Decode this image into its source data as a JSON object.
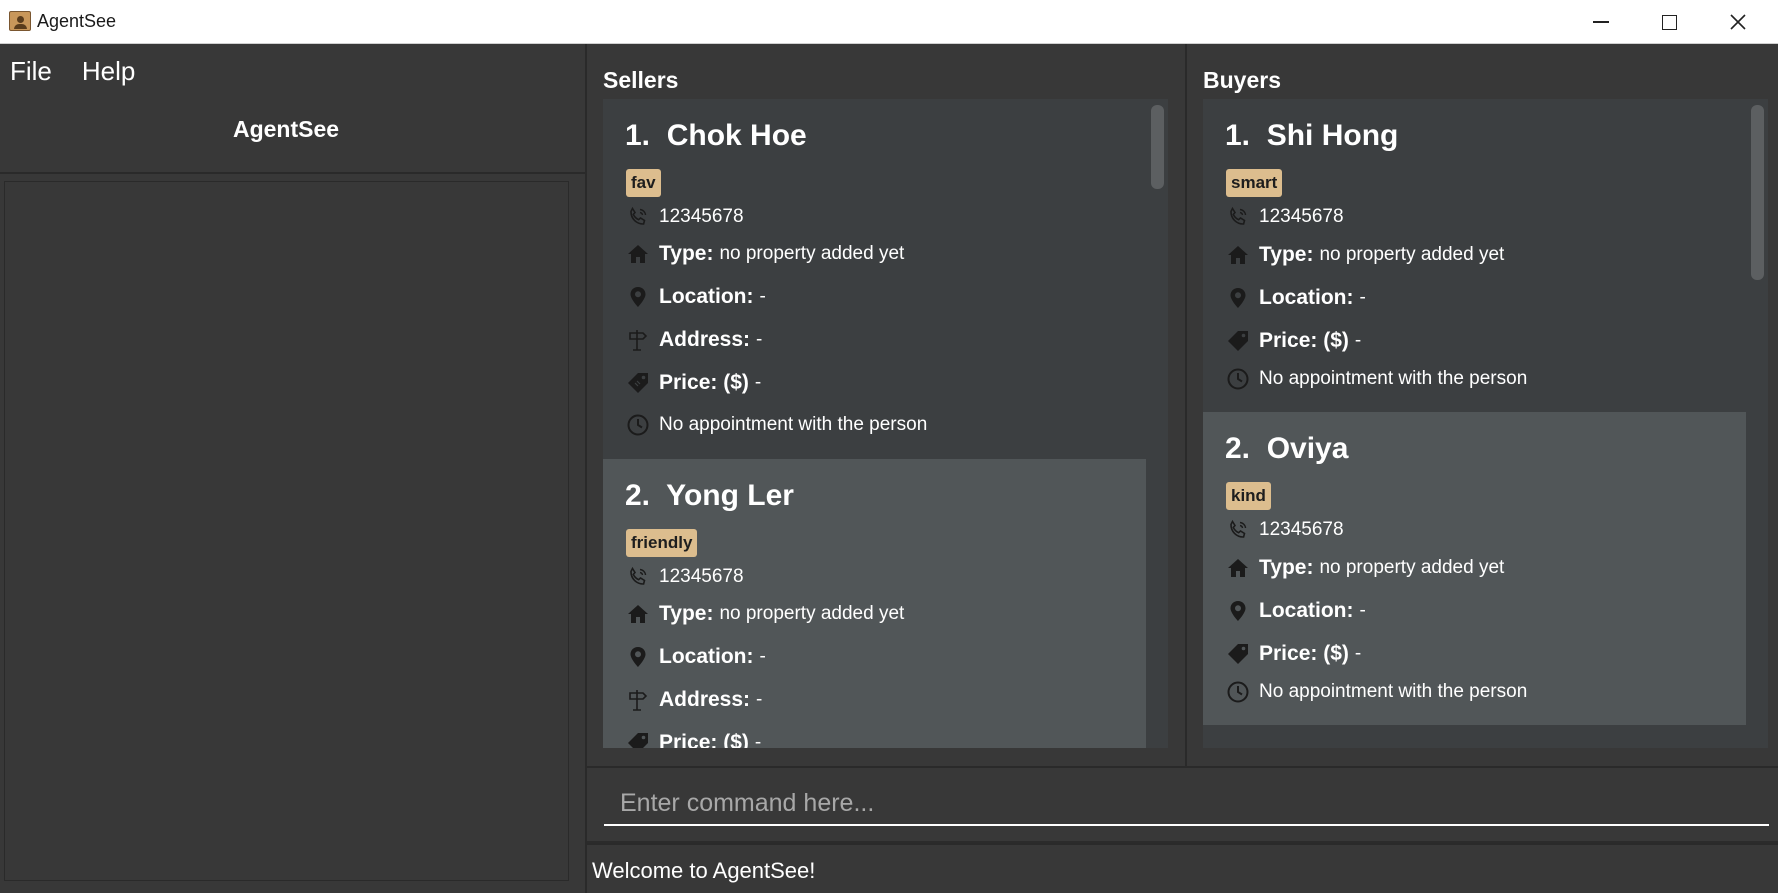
{
  "window": {
    "title": "AgentSee"
  },
  "menu": {
    "file": "File",
    "help": "Help"
  },
  "left_panel": {
    "title": "AgentSee"
  },
  "sellers": {
    "header": "Sellers",
    "cards": [
      {
        "index": "1.",
        "name": "Chok Hoe",
        "tag": "fav",
        "phone": "12345678",
        "type_label": "Type:",
        "type_value": "no property added yet",
        "location_label": "Location:",
        "location_value": "-",
        "address_label": "Address:",
        "address_value": "-",
        "price_label": "Price: ($)",
        "price_value": "-",
        "appointment": "No appointment with the person"
      },
      {
        "index": "2.",
        "name": "Yong Ler",
        "tag": "friendly",
        "phone": "12345678",
        "type_label": "Type:",
        "type_value": "no property added yet",
        "location_label": "Location:",
        "location_value": "-",
        "address_label": "Address:",
        "address_value": "-",
        "price_label": "Price: ($)",
        "price_value": "-"
      }
    ]
  },
  "buyers": {
    "header": "Buyers",
    "cards": [
      {
        "index": "1.",
        "name": "Shi Hong",
        "tag": "smart",
        "phone": "12345678",
        "type_label": "Type:",
        "type_value": "no property added yet",
        "location_label": "Location:",
        "location_value": "-",
        "price_label": "Price: ($)",
        "price_value": "-",
        "appointment": "No appointment with the person"
      },
      {
        "index": "2.",
        "name": "Oviya",
        "tag": "kind",
        "phone": "12345678",
        "type_label": "Type:",
        "type_value": "no property added yet",
        "location_label": "Location:",
        "location_value": "-",
        "price_label": "Price: ($)",
        "price_value": "-",
        "appointment": "No appointment with the person"
      }
    ]
  },
  "command": {
    "placeholder": "Enter command here..."
  },
  "result": {
    "message": "Welcome to AgentSee!"
  },
  "icons": {
    "phone": "phone-icon",
    "type": "home-icon",
    "location": "map-pin-icon",
    "address": "signpost-icon",
    "price": "price-tag-icon",
    "appointment": "clock-icon"
  },
  "colors": {
    "background": "#383838",
    "card_odd": "#3c3f41",
    "card_even": "#515658",
    "tag": "#dcbd8e",
    "text": "#ffffff"
  }
}
